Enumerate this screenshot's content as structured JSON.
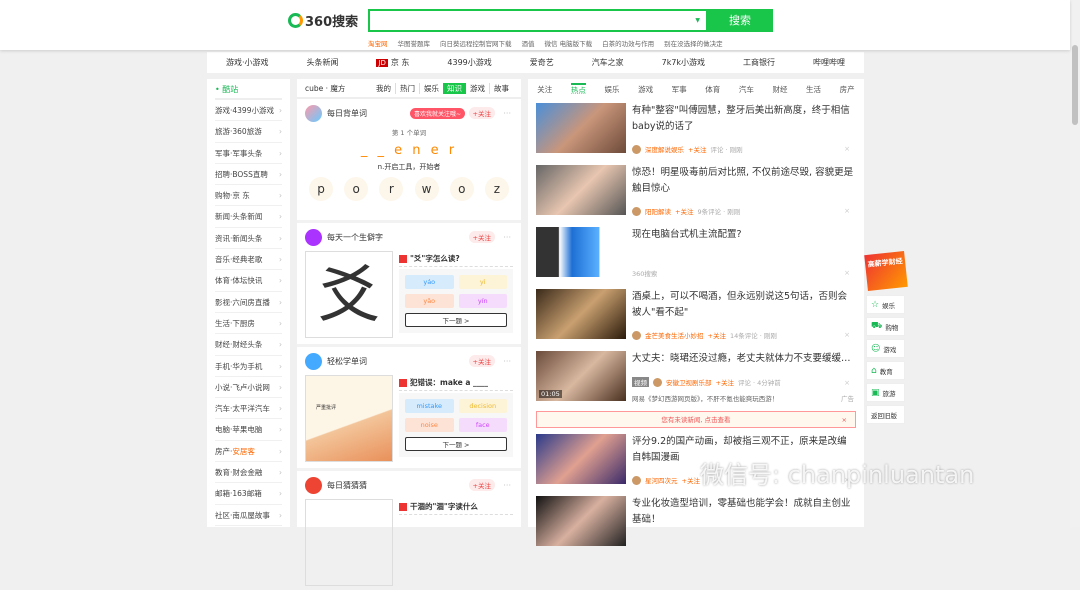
{
  "header": {
    "logo": "360搜索",
    "search_button": "搜索",
    "search_value": "",
    "hot": [
      "淘宝网",
      "华图誉题库",
      "向日葵远程控制官网下载",
      "酒值",
      "微信 电脑版下载",
      "白茶的功效与作用",
      "别在没选择的做决定"
    ]
  },
  "nav": [
    "游戏·小游戏",
    "头条新闻",
    "京 东",
    "4399小游戏",
    "爱奇艺",
    "汽车之家",
    "7k7k小游戏",
    "工商银行",
    "哔哩哔哩"
  ],
  "sidebar": {
    "title": "• 酷站",
    "items": [
      {
        "a": "游戏·",
        "b": "4399小游戏"
      },
      {
        "a": "旅游·",
        "b": "360旅游"
      },
      {
        "a": "军事·",
        "b": "军事头条"
      },
      {
        "a": "招聘·",
        "b": "BOSS直聘"
      },
      {
        "a": "购物·",
        "b": "京 东"
      },
      {
        "a": "新闻·",
        "b": "头条新闻"
      },
      {
        "a": "资讯·",
        "b": "新闻头条"
      },
      {
        "a": "音乐·",
        "b": "经典老歌"
      },
      {
        "a": "体育·",
        "b": "体坛快讯"
      },
      {
        "a": "影视·",
        "b": "六间房直播"
      },
      {
        "a": "生活·",
        "b": "下厨房"
      },
      {
        "a": "财经·",
        "b": "财经头条"
      },
      {
        "a": "手机·",
        "b": "华为手机"
      },
      {
        "a": "小说·",
        "b": "飞卢小说网"
      },
      {
        "a": "汽车·",
        "b": "太平洋汽车"
      },
      {
        "a": "电脑·",
        "b": "苹果电脑"
      },
      {
        "a": "房产·",
        "b": "安居客"
      },
      {
        "a": "教育·",
        "b": "财会金融"
      },
      {
        "a": "邮箱·",
        "b": "163邮箱"
      },
      {
        "a": "社区·",
        "b": "南瓜屋故事"
      }
    ]
  },
  "middle": {
    "title": "cube · 魔方",
    "tabs": [
      "我的",
      "热门",
      "娱乐",
      "知识",
      "游戏",
      "故事"
    ],
    "follow": "+关注",
    "promo": "喜欢我就关注哦~",
    "cards": [
      {
        "name": "每日背单词",
        "word_index": "第 1 个单词",
        "word": "_ _ e n e r",
        "meaning": "n.开启工具，开始者",
        "letters": [
          "p",
          "o",
          "r",
          "w",
          "o",
          "z"
        ]
      },
      {
        "name": "每天一个生僻字",
        "char": "爻",
        "question": "\"爻\"字怎么读?",
        "options": [
          "yáo",
          "yì",
          "yǎo",
          "yín"
        ],
        "next": "下一题 >"
      },
      {
        "name": "轻松学单词",
        "question": "犯错误：make a ____",
        "options": [
          "mistake",
          "decision",
          "noise",
          "face"
        ],
        "next": "下一题 >",
        "pic_text": "严重批评"
      },
      {
        "name": "每日猜猜猜",
        "question": "干涸的\"涸\"字读什么"
      }
    ]
  },
  "news": {
    "tabs": [
      "关注",
      "热点",
      "娱乐",
      "游戏",
      "军事",
      "体育",
      "汽车",
      "财经",
      "生活",
      "房产"
    ],
    "items": [
      {
        "title": "有种\"整容\"叫傅园慧，整牙后美出新高度，终于相信baby说的话了",
        "source": "深度解说娱乐",
        "follow": "+关注",
        "meta": "评论 · 刚刚"
      },
      {
        "title": "惊恐！明星吸毒前后对比照, 不仅前途尽毁, 容貌更是触目惊心",
        "source": "阳阳解读",
        "follow": "+关注",
        "meta": "9条评论 · 刚刚"
      },
      {
        "title": "现在电脑台式机主流配置?",
        "source": "360搜索"
      },
      {
        "title": "酒桌上，可以不喝酒，但永远别说这5句话，否则会被人\"看不起\"",
        "source": "金芒美食生活小妙招",
        "follow": "+关注",
        "meta": "14条评论 · 刚刚"
      },
      {
        "title": "大丈夫：晓珺还没过瘾，老丈夫就体力不支要缓缓…",
        "tag": "视频",
        "source": "安徽卫视剧乐部",
        "follow": "+关注",
        "meta": "评论 · 4分钟前",
        "duration": "01:05",
        "ad": "网易《梦幻西游网页版》，不肝不氪也能爽玩西游！",
        "ad_label": "广告"
      }
    ],
    "alert": "您有未读新闻, 点击查看",
    "items2": [
      {
        "title": "评分9.2的国产动画，却被指三观不正，原来是改编自韩国漫画",
        "source": "星河四次元",
        "follow": "+关注"
      },
      {
        "title": "专业化妆造型培训，零基础也能学会！成就自主创业基础！"
      }
    ]
  },
  "float": {
    "badge": "高薪学财经",
    "items": [
      "娱乐",
      "购物",
      "游戏",
      "教育",
      "旅游"
    ],
    "back": "返回旧版"
  },
  "watermark": "微信号: chanpinluantan"
}
